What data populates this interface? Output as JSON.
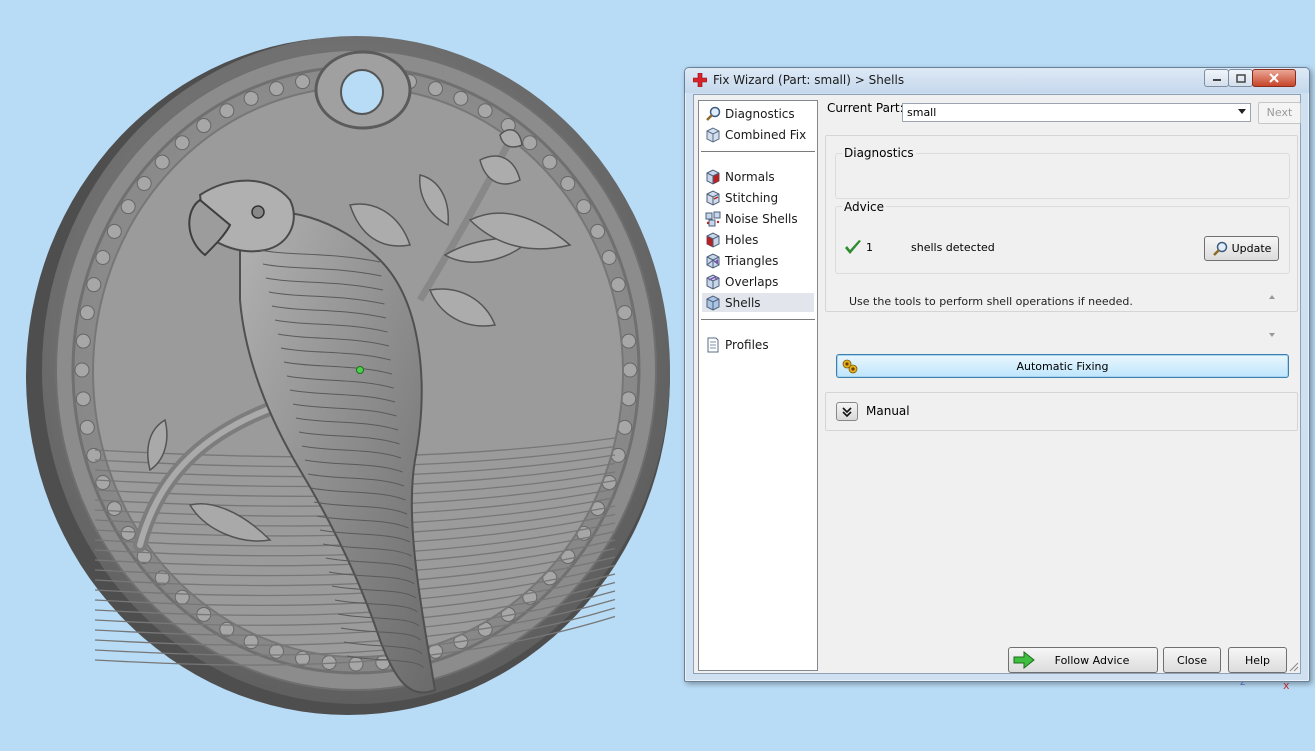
{
  "viewport": {
    "object": "parrot-pendant",
    "background_color": "#b9dcf6",
    "axis_labels": {
      "z": "z",
      "x": "x"
    }
  },
  "window": {
    "title": "Fix Wizard (Part: small) > Shells",
    "app_icon": "red-cross-icon",
    "controls": {
      "minimize": "minimize-icon",
      "maximize": "maximize-icon",
      "close": "close-icon"
    }
  },
  "nav": {
    "top_items": [
      {
        "label": "Diagnostics",
        "icon": "magnifier-icon"
      },
      {
        "label": "Combined Fix",
        "icon": "cube-icon"
      }
    ],
    "tool_items": [
      {
        "label": "Normals",
        "icon": "normals-cube-icon"
      },
      {
        "label": "Stitching",
        "icon": "stitching-cube-icon"
      },
      {
        "label": "Noise Shells",
        "icon": "noise-shells-icon"
      },
      {
        "label": "Holes",
        "icon": "holes-cube-icon"
      },
      {
        "label": "Triangles",
        "icon": "triangles-cube-icon"
      },
      {
        "label": "Overlaps",
        "icon": "overlaps-cube-icon"
      },
      {
        "label": "Shells",
        "icon": "shells-cube-icon",
        "selected": true
      }
    ],
    "bottom_items": [
      {
        "label": "Profiles",
        "icon": "document-icon"
      }
    ]
  },
  "current_part": {
    "label": "Current Part:",
    "value": "small",
    "next_label": "Next"
  },
  "diagnostics": {
    "label": "Diagnostics",
    "count": "1",
    "text": "shells detected",
    "status_icon": "checkmark-icon",
    "status_color": "#2e8b2e",
    "update_label": "Update"
  },
  "advice": {
    "label": "Advice",
    "text": "Use the tools to perform shell operations if needed."
  },
  "automatic_fixing": {
    "label": "Automatic Fixing",
    "icon": "sunflower-icon"
  },
  "manual": {
    "label": "Manual",
    "icon": "double-chevron-down-icon"
  },
  "footer": {
    "follow_advice": "Follow Advice",
    "follow_icon": "green-arrow-icon",
    "close": "Close",
    "help": "Help"
  }
}
